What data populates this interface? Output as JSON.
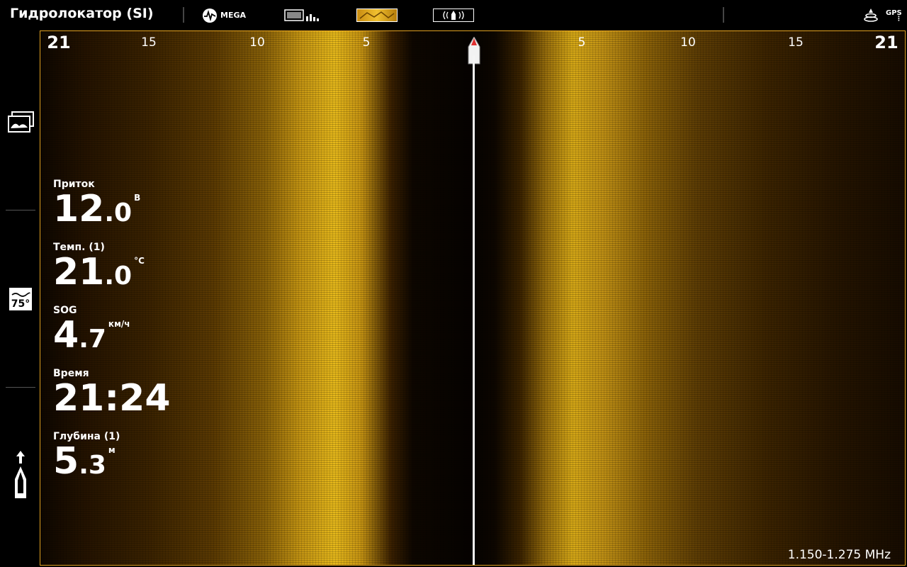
{
  "header": {
    "title": "Гидролокатор (SI)",
    "mega_label": "MEGA",
    "gps_label": "GPS"
  },
  "sidebar": {
    "temp_icon_label": "75°"
  },
  "sonar": {
    "scale_left": [
      "21",
      "15",
      "10",
      "5"
    ],
    "scale_right": [
      "5",
      "10",
      "15",
      "21"
    ],
    "frequency": "1.150-1.275 MHz"
  },
  "readouts": [
    {
      "label": "Приток",
      "int": "12",
      "dec": ".0",
      "unit": "В"
    },
    {
      "label": "Темп. (1)",
      "int": "21",
      "dec": ".0",
      "unit": "°C"
    },
    {
      "label": "SOG",
      "int": "4",
      "dec": ".7",
      "unit": "км/ч"
    },
    {
      "label": "Время",
      "int": "21:24",
      "dec": "",
      "unit": ""
    },
    {
      "label": "Глубина (1)",
      "int": "5",
      "dec": ".3",
      "unit": "м"
    }
  ],
  "colors": {
    "accent": "#e0a020",
    "sonar_bright": "#e6b81a",
    "background": "#000000"
  }
}
